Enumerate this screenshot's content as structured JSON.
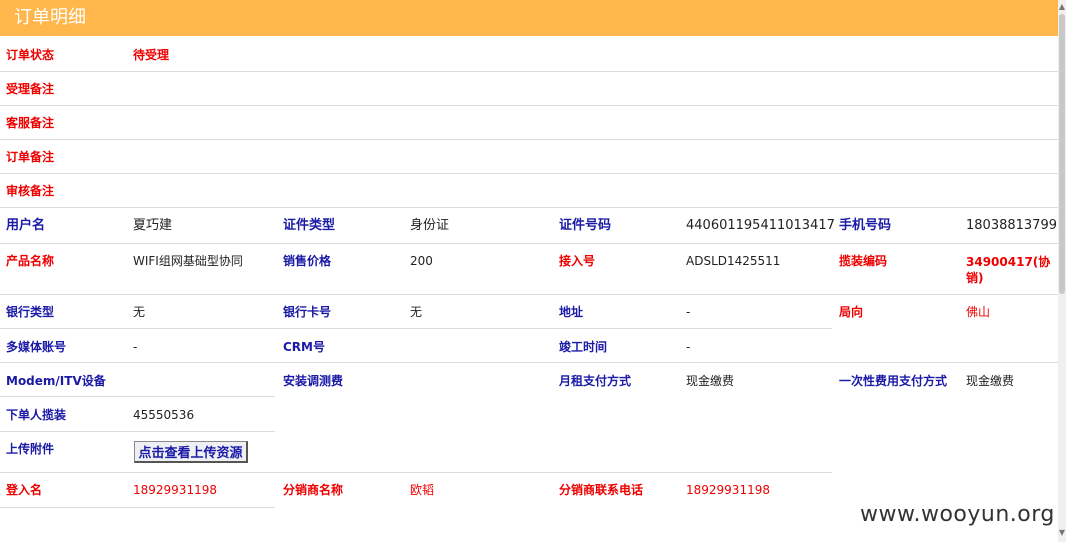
{
  "header": {
    "title": "订单明细"
  },
  "order_status": {
    "label": "订单状态",
    "value": "待受理"
  },
  "notes": [
    {
      "label": "受理备注",
      "value": ""
    },
    {
      "label": "客服备注",
      "value": ""
    },
    {
      "label": "订单备注",
      "value": ""
    },
    {
      "label": "审核备注",
      "value": ""
    }
  ],
  "row_user": {
    "user_name_label": "用户名",
    "user_name": "夏巧建",
    "id_type_label": "证件类型",
    "id_type": "身份证",
    "id_no_label": "证件号码",
    "id_no": "440601195411013417",
    "phone_label": "手机号码",
    "phone": "18038813799"
  },
  "row_product": {
    "product_label": "产品名称",
    "product": "WIFI组网基础型协同",
    "price_label": "销售价格",
    "price": "200",
    "access_label": "接入号",
    "access": "ADSLD1425511",
    "install_code_label": "揽装编码",
    "install_code": "34900417(协销)"
  },
  "row_bank": {
    "bank_type_label": "银行类型",
    "bank_type": "无",
    "bank_card_label": "银行卡号",
    "bank_card": "无",
    "address_label": "地址",
    "address": "-",
    "direction_label": "局向",
    "direction": "佛山"
  },
  "row_media": {
    "media_label": "多媒体账号",
    "media": "-",
    "crm_label": "CRM号",
    "crm": "",
    "finish_label": "竣工时间",
    "finish": "-"
  },
  "row_modem": {
    "modem_label": "Modem/ITV设备",
    "modem": "",
    "setup_fee_label": "安装调测费",
    "setup_fee": "",
    "monthly_pay_label": "月租支付方式",
    "monthly_pay": "现金缴费",
    "onetime_pay_label": "一次性费用支付方式",
    "onetime_pay": "现金缴费"
  },
  "row_order_person": {
    "label": "下单人揽装",
    "value": "45550536"
  },
  "row_upload": {
    "label": "上传附件",
    "button": "点击查看上传资源"
  },
  "row_login": {
    "login_label": "登入名",
    "login": "18929931198",
    "dist_name_label": "分销商名称",
    "dist_name": "欧韬",
    "dist_phone_label": "分销商联系电话",
    "dist_phone": "18929931198"
  },
  "watermark": "www.wooyun.org",
  "colors": {
    "header_bg": "#ffb64a",
    "label_red": "#e00000",
    "label_blue": "#1a1aa6",
    "border": "#dcdcdc"
  }
}
